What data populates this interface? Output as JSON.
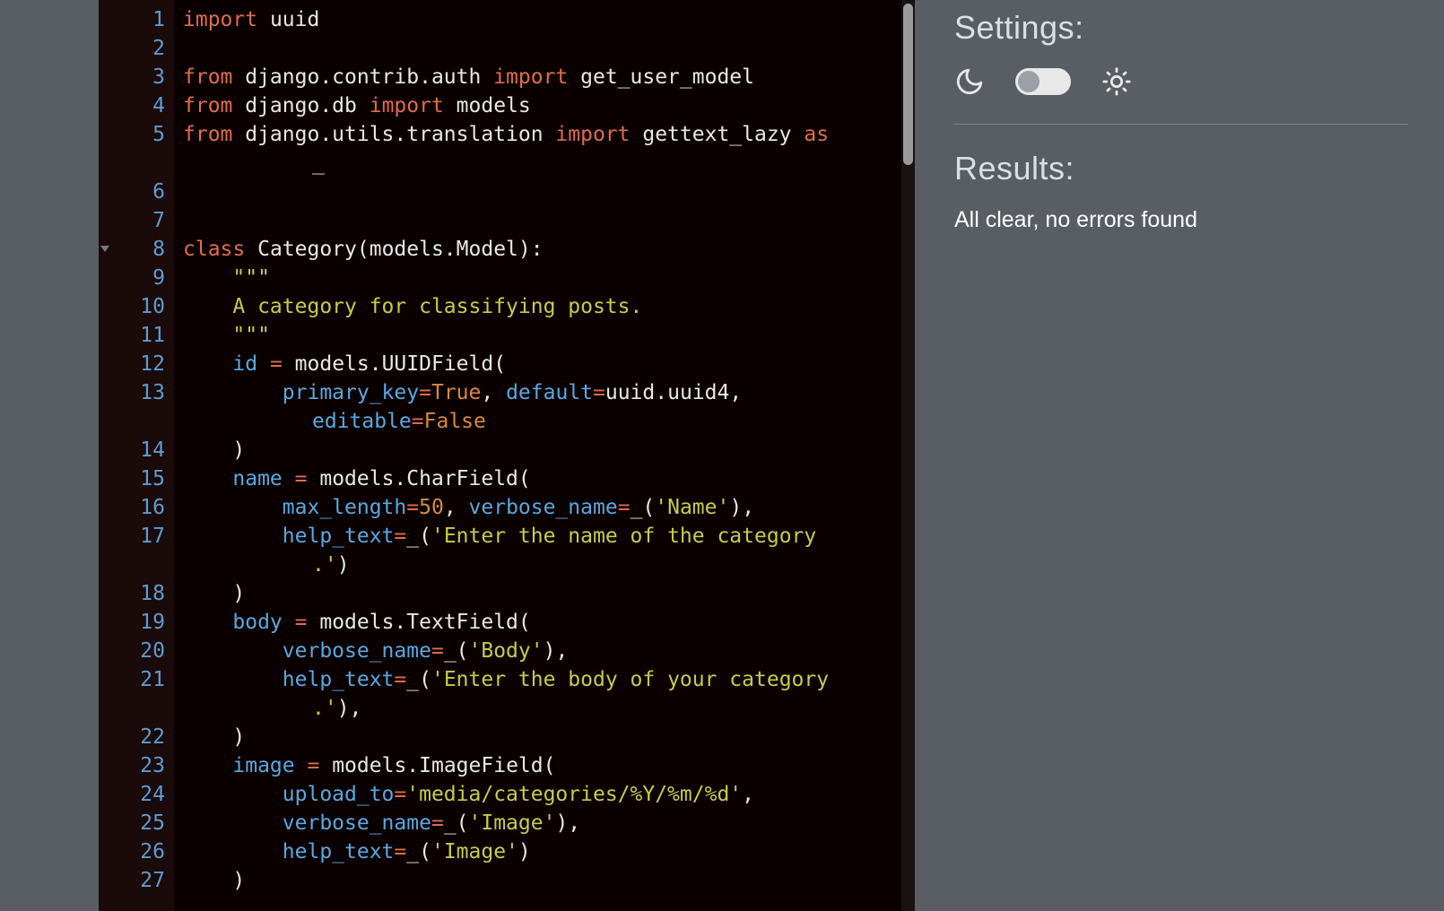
{
  "settings": {
    "heading": "Settings:",
    "theme_toggle_state": "dark"
  },
  "results": {
    "heading": "Results:",
    "message": "All clear, no errors found"
  },
  "editor": {
    "language": "python",
    "lines": [
      {
        "n": 1,
        "t": [
          [
            "kw",
            "import"
          ],
          [
            "id",
            " uuid"
          ]
        ]
      },
      {
        "n": 2,
        "t": []
      },
      {
        "n": 3,
        "t": [
          [
            "kw",
            "from"
          ],
          [
            "id",
            " django.contrib.auth "
          ],
          [
            "kw",
            "import"
          ],
          [
            "id",
            " get_user_model"
          ]
        ]
      },
      {
        "n": 4,
        "t": [
          [
            "kw",
            "from"
          ],
          [
            "id",
            " django.db "
          ],
          [
            "kw",
            "import"
          ],
          [
            "id",
            " models"
          ]
        ]
      },
      {
        "n": 5,
        "t": [
          [
            "kw",
            "from"
          ],
          [
            "id",
            " django.utils.translation "
          ],
          [
            "kw",
            "import"
          ],
          [
            "id",
            " gettext_lazy "
          ],
          [
            "kw",
            "as"
          ]
        ]
      },
      {
        "n": 5,
        "wrap": true,
        "t": [
          [
            "id",
            "_"
          ]
        ]
      },
      {
        "n": 6,
        "t": []
      },
      {
        "n": 7,
        "t": []
      },
      {
        "n": 8,
        "fold": true,
        "t": [
          [
            "kw",
            "class"
          ],
          [
            "id",
            " Category(models.Model):"
          ]
        ]
      },
      {
        "n": 9,
        "t": [
          [
            "id",
            "    "
          ],
          [
            "doc",
            "\"\"\""
          ]
        ]
      },
      {
        "n": 10,
        "t": [
          [
            "id",
            "    "
          ],
          [
            "doc",
            "A category for classifying posts."
          ]
        ]
      },
      {
        "n": 11,
        "t": [
          [
            "id",
            "    "
          ],
          [
            "doc",
            "\"\"\""
          ]
        ]
      },
      {
        "n": 12,
        "t": [
          [
            "id",
            "    "
          ],
          [
            "def",
            "id"
          ],
          [
            "id",
            " "
          ],
          [
            "op",
            "="
          ],
          [
            "id",
            " models.UUIDField("
          ]
        ]
      },
      {
        "n": 13,
        "t": [
          [
            "id",
            "        "
          ],
          [
            "def",
            "primary_key"
          ],
          [
            "op",
            "="
          ],
          [
            "bool",
            "True"
          ],
          [
            "id",
            ", "
          ],
          [
            "def",
            "default"
          ],
          [
            "op",
            "="
          ],
          [
            "id",
            "uuid.uuid4,"
          ]
        ]
      },
      {
        "n": 13,
        "wrap": true,
        "t": [
          [
            "def",
            "editable"
          ],
          [
            "op",
            "="
          ],
          [
            "bool",
            "False"
          ]
        ]
      },
      {
        "n": 14,
        "t": [
          [
            "id",
            "    )"
          ]
        ]
      },
      {
        "n": 15,
        "t": [
          [
            "id",
            "    "
          ],
          [
            "def",
            "name"
          ],
          [
            "id",
            " "
          ],
          [
            "op",
            "="
          ],
          [
            "id",
            " models.CharField("
          ]
        ]
      },
      {
        "n": 16,
        "t": [
          [
            "id",
            "        "
          ],
          [
            "def",
            "max_length"
          ],
          [
            "op",
            "="
          ],
          [
            "num",
            "50"
          ],
          [
            "id",
            ", "
          ],
          [
            "def",
            "verbose_name"
          ],
          [
            "op",
            "="
          ],
          [
            "id",
            "_("
          ],
          [
            "str",
            "'Name'"
          ],
          [
            "id",
            "),"
          ]
        ]
      },
      {
        "n": 17,
        "t": [
          [
            "id",
            "        "
          ],
          [
            "def",
            "help_text"
          ],
          [
            "op",
            "="
          ],
          [
            "id",
            "_("
          ],
          [
            "str",
            "'Enter the name of the category"
          ]
        ]
      },
      {
        "n": 17,
        "wrap": true,
        "t": [
          [
            "str",
            ".'"
          ],
          [
            "id",
            ")"
          ]
        ]
      },
      {
        "n": 18,
        "t": [
          [
            "id",
            "    )"
          ]
        ]
      },
      {
        "n": 19,
        "t": [
          [
            "id",
            "    "
          ],
          [
            "def",
            "body"
          ],
          [
            "id",
            " "
          ],
          [
            "op",
            "="
          ],
          [
            "id",
            " models.TextField("
          ]
        ]
      },
      {
        "n": 20,
        "t": [
          [
            "id",
            "        "
          ],
          [
            "def",
            "verbose_name"
          ],
          [
            "op",
            "="
          ],
          [
            "id",
            "_("
          ],
          [
            "str",
            "'Body'"
          ],
          [
            "id",
            "),"
          ]
        ]
      },
      {
        "n": 21,
        "t": [
          [
            "id",
            "        "
          ],
          [
            "def",
            "help_text"
          ],
          [
            "op",
            "="
          ],
          [
            "id",
            "_("
          ],
          [
            "str",
            "'Enter the body of your category"
          ]
        ]
      },
      {
        "n": 21,
        "wrap": true,
        "t": [
          [
            "str",
            ".'"
          ],
          [
            "id",
            "),"
          ]
        ]
      },
      {
        "n": 22,
        "t": [
          [
            "id",
            "    )"
          ]
        ]
      },
      {
        "n": 23,
        "t": [
          [
            "id",
            "    "
          ],
          [
            "def",
            "image"
          ],
          [
            "id",
            " "
          ],
          [
            "op",
            "="
          ],
          [
            "id",
            " models.ImageField("
          ]
        ]
      },
      {
        "n": 24,
        "t": [
          [
            "id",
            "        "
          ],
          [
            "def",
            "upload_to"
          ],
          [
            "op",
            "="
          ],
          [
            "str",
            "'media/categories/%Y/%m/%d'"
          ],
          [
            "id",
            ","
          ]
        ]
      },
      {
        "n": 25,
        "t": [
          [
            "id",
            "        "
          ],
          [
            "def",
            "verbose_name"
          ],
          [
            "op",
            "="
          ],
          [
            "id",
            "_("
          ],
          [
            "str",
            "'Image'"
          ],
          [
            "id",
            "),"
          ]
        ]
      },
      {
        "n": 26,
        "t": [
          [
            "id",
            "        "
          ],
          [
            "def",
            "help_text"
          ],
          [
            "op",
            "="
          ],
          [
            "id",
            "_("
          ],
          [
            "str",
            "'Image'"
          ],
          [
            "id",
            ")"
          ]
        ]
      },
      {
        "n": 27,
        "t": [
          [
            "id",
            "    )"
          ]
        ]
      }
    ]
  }
}
